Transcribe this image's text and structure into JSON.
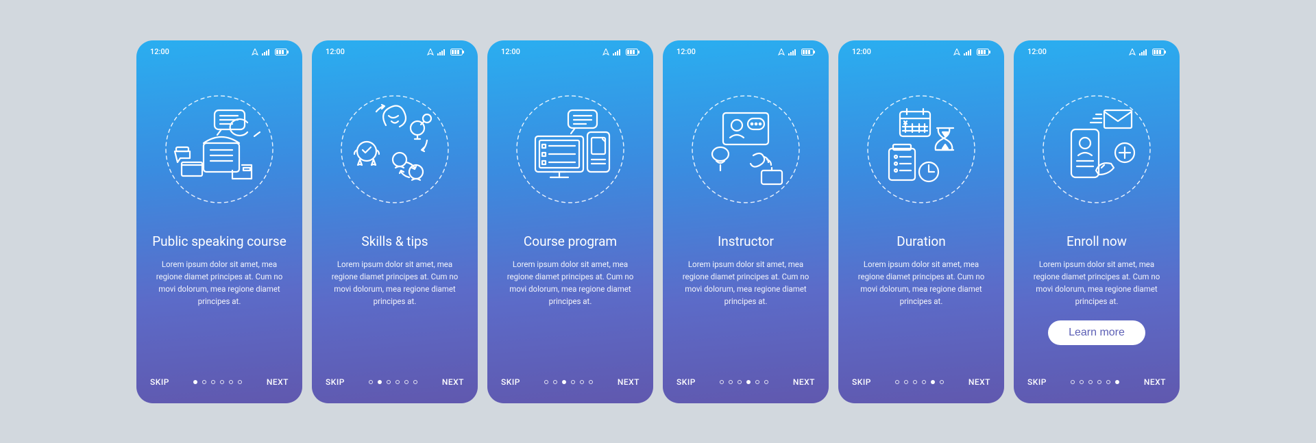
{
  "status": {
    "time": "12:00"
  },
  "common": {
    "skip": "SKIP",
    "next": "NEXT",
    "desc": "Lorem ipsum dolor sit amet, mea regione diamet principes at. Cum no movi dolorum, mea regione diamet principes at."
  },
  "learn_more": "Learn more",
  "screens": [
    {
      "title": "Public speaking course",
      "icon": "public-speaking"
    },
    {
      "title": "Skills & tips",
      "icon": "skills-tips"
    },
    {
      "title": "Course program",
      "icon": "course-program"
    },
    {
      "title": "Instructor",
      "icon": "instructor"
    },
    {
      "title": "Duration",
      "icon": "duration"
    },
    {
      "title": "Enroll now",
      "icon": "enroll-now",
      "cta": true
    }
  ]
}
